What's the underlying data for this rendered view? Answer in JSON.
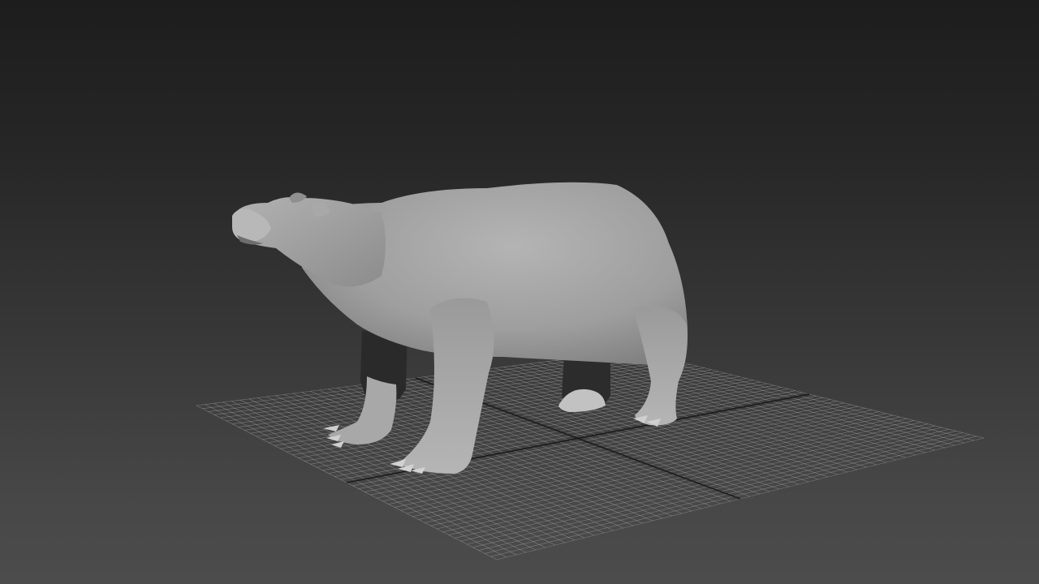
{
  "viewport": {
    "render_mode": "shaded",
    "background_colors": {
      "top": "#1d1d1d",
      "bottom": "#4c4c4c"
    },
    "grid_color": "#a9a9a9",
    "grid_axis_color": "#141414",
    "model_color": "#a5a5a5",
    "model": {
      "icon": "bear-model"
    }
  }
}
